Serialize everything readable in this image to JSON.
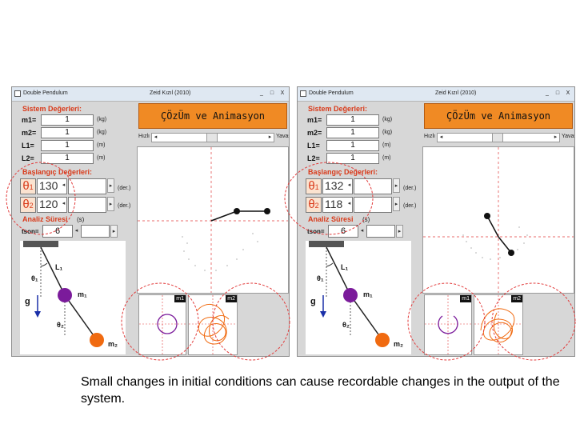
{
  "caption": "Small changes in initial conditions can cause recordable changes in the output of the system.",
  "colors": {
    "accent": "#f08a24",
    "section_label": "#d93a1a",
    "mass1": "#7b1b9b",
    "mass2": "#f06a10"
  },
  "windows": [
    {
      "title": "Double Pendulum",
      "author": "Zeid Kızıl (2010)",
      "controls": [
        "_",
        "□",
        "X"
      ],
      "system_label": "Sistem Değerleri:",
      "params": [
        {
          "name": "m1=",
          "value": "1",
          "unit": "(kg)"
        },
        {
          "name": "m2=",
          "value": "1",
          "unit": "(kg)"
        },
        {
          "name": "L1=",
          "value": "1",
          "unit": "(m)"
        },
        {
          "name": "L2=",
          "value": "1",
          "unit": "(m)"
        }
      ],
      "initial_label": "Başlangıç Değerleri:",
      "theta1": {
        "symbol": "θ",
        "sub": "1",
        "value": "130",
        "unit": "(der.)"
      },
      "theta2": {
        "symbol": "θ",
        "sub": "2",
        "value": "120",
        "unit": "(der.)"
      },
      "analysis_label": "Analiz Süresi",
      "analysis_unit": "(s)",
      "tson_label": "tson=",
      "tson_value": "6",
      "banner": "ÇÖzÜm ve Animasyon",
      "speed_fast": "Hızlı",
      "speed_slow": "Yavaş",
      "schematic": {
        "L1": "L₁",
        "theta1": "θ₁",
        "m1": "m₁",
        "g": "g",
        "theta2": "θ₂",
        "m2": "m₂"
      },
      "plot1_tag": "m1",
      "plot2_tag": "m2"
    },
    {
      "title": "Double Pendulum",
      "author": "Zeid Kızıl (2010)",
      "controls": [
        "_",
        "□",
        "X"
      ],
      "system_label": "Sistem Değerleri:",
      "params": [
        {
          "name": "m1=",
          "value": "1",
          "unit": "(kg)"
        },
        {
          "name": "m2=",
          "value": "1",
          "unit": "(kg)"
        },
        {
          "name": "L1=",
          "value": "1",
          "unit": "(m)"
        },
        {
          "name": "L2=",
          "value": "1",
          "unit": "(m)"
        }
      ],
      "initial_label": "Başlangıç Değerleri:",
      "theta1": {
        "symbol": "θ",
        "sub": "1",
        "value": "132",
        "unit": "(der.)"
      },
      "theta2": {
        "symbol": "θ",
        "sub": "2",
        "value": "118",
        "unit": "(der.)"
      },
      "analysis_label": "Analiz Süresi",
      "analysis_unit": "(s)",
      "tson_label": "tson=",
      "tson_value": "6",
      "banner": "ÇÖzÜm ve Animasyon",
      "speed_fast": "Hızlı",
      "speed_slow": "Yavaş",
      "schematic": {
        "L1": "L₁",
        "theta1": "θ₁",
        "m1": "m₁",
        "g": "g",
        "theta2": "θ₂",
        "m2": "m₂"
      },
      "plot1_tag": "m1",
      "plot2_tag": "m2"
    }
  ]
}
